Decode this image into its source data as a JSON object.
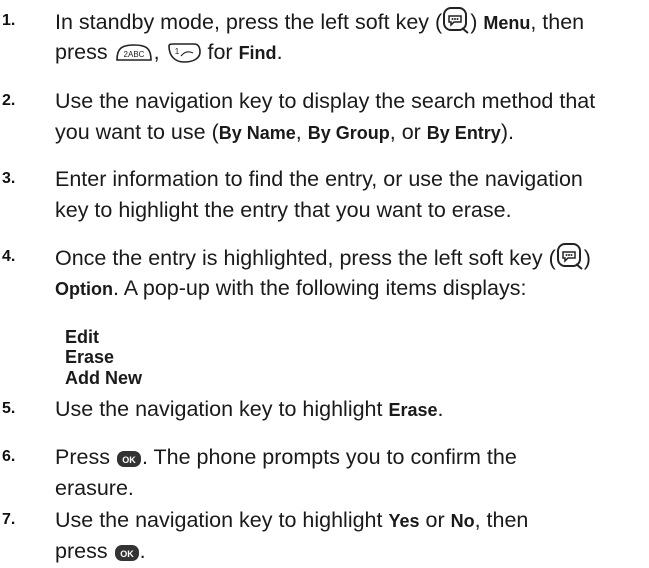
{
  "steps": [
    {
      "number": "1.",
      "line1": [
        "In standby mode, press the left soft key (",
        ") ",
        "Menu",
        ", then"
      ],
      "line2": [
        "press ",
        ", ",
        " for ",
        "Find",
        "."
      ]
    },
    {
      "number": "2.",
      "line1": "Use the navigation key to display the search method that",
      "line2": [
        "you want to use (",
        "By Name",
        ", ",
        "By Group",
        ", or ",
        "By Entry",
        ")."
      ]
    },
    {
      "number": "3.",
      "line1": "Enter information to find the entry, or use the navigation",
      "line2": "key to highlight the entry that you want to erase."
    },
    {
      "number": "4.",
      "line1": "Once the entry is highlighted, press the left soft key (",
      "line1_end": ")",
      "line2": [
        "Option",
        ". A pop-up with the following items displays:"
      ]
    },
    {
      "number": "5.",
      "line1": [
        "Use the navigation key to highlight ",
        "Erase",
        "."
      ]
    },
    {
      "number": "6.",
      "line1": [
        "Press ",
        ". The phone prompts you to confirm the"
      ],
      "line2": "erasure."
    },
    {
      "number": "7.",
      "line1": [
        "Use the navigation key to highlight ",
        "Yes",
        " or ",
        "No",
        ", then"
      ],
      "line2": [
        "press ",
        "."
      ]
    }
  ],
  "popup_items": [
    "Edit",
    "Erase",
    "Add New"
  ],
  "icons": {
    "soft_key": "left-soft-key-icon",
    "key_2": "key-2-abc-icon",
    "key_1": "key-1-icon",
    "ok": "ok-key-icon"
  },
  "key_labels": {
    "key_2": "2ABC",
    "key_1": "1",
    "ok": "OK"
  }
}
